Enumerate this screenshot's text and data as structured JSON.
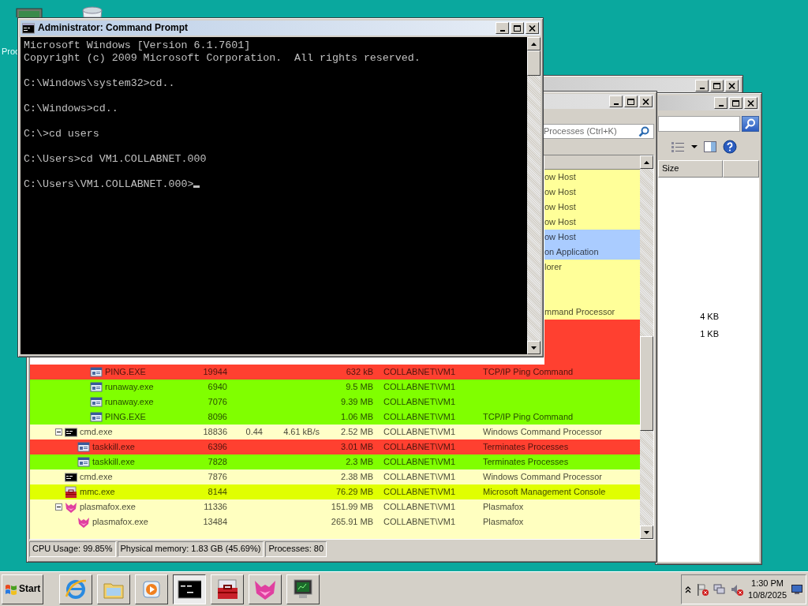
{
  "desktop": {
    "icon_label": "Proc"
  },
  "command_prompt": {
    "title": "Administrator: Command Prompt",
    "blocks": [
      [
        "Microsoft Windows [Version 6.1.7601]",
        "Copyright (c) 2009 Microsoft Corporation.  All rights reserved."
      ],
      [
        "C:\\Windows\\system32>cd.."
      ],
      [
        "C:\\Windows>cd.."
      ],
      [
        "C:\\>cd users"
      ],
      [
        "C:\\Users>cd VM1.COLLABNET.000"
      ],
      [
        "C:\\Users\\VM1.COLLABNET.000>"
      ]
    ],
    "cursor": true
  },
  "process_explorer": {
    "search": {
      "placeholder": "Processes (Ctrl+K)"
    },
    "rows": [
      {
        "kind": "covered",
        "description": "ow Host",
        "color": "#ffff99"
      },
      {
        "kind": "covered",
        "description": "ow Host",
        "color": "#ffff99"
      },
      {
        "kind": "covered",
        "description": "ow Host",
        "color": "#ffff99"
      },
      {
        "kind": "covered",
        "description": "ow Host",
        "color": "#ffff99"
      },
      {
        "kind": "covered",
        "description": "ow Host",
        "color": "#aaccff"
      },
      {
        "kind": "covered",
        "description": "on Application",
        "color": "#aaccff"
      },
      {
        "kind": "covered",
        "description": "lorer",
        "color": "#ffff99"
      },
      {
        "kind": "covered",
        "color": "#ffff99"
      },
      {
        "kind": "covered",
        "color": "#ffff99"
      },
      {
        "kind": "covered",
        "description": "mmand Processor",
        "color": "#ffff99",
        "children": [
          {
            "kind": "covered",
            "color": "#ff4030"
          },
          {
            "kind": "covered",
            "color": "#ff4030",
            "children": [
              {
                "kind": "covered",
                "color": "#ff4030"
              },
              {
                "kind": "window",
                "name": "PING.EXE",
                "pid": "19944",
                "memory": "632 kB",
                "user": "COLLABNET\\VM1",
                "description": "TCP/IP Ping Command",
                "color": "#ff4030",
                "expanded": false
              },
              {
                "kind": "window",
                "name": "runaway.exe",
                "pid": "6940",
                "memory": "9.5 MB",
                "user": "COLLABNET\\VM1",
                "color": "#80ff00",
                "expanded": false
              },
              {
                "kind": "window",
                "name": "runaway.exe",
                "pid": "7076",
                "memory": "9.39 MB",
                "user": "COLLABNET\\VM1",
                "color": "#80ff00",
                "expanded": false
              },
              {
                "kind": "window",
                "name": "PING.EXE",
                "pid": "8096",
                "memory": "1.06 MB",
                "user": "COLLABNET\\VM1",
                "description": "TCP/IP Ping Command",
                "color": "#80ff00",
                "expanded": false
              }
            ]
          }
        ]
      },
      {
        "kind": "console",
        "name": "cmd.exe",
        "pid": "18836",
        "cpu": "0.44",
        "io": "4.61 kB/s",
        "memory": "2.52 MB",
        "user": "COLLABNET\\VM1",
        "description": "Windows Command Processor",
        "color": "#ffffc8",
        "expanded": true,
        "children": [
          {
            "kind": "window",
            "name": "taskkill.exe",
            "pid": "6396",
            "memory": "3.01 MB",
            "user": "COLLABNET\\VM1",
            "description": "Terminates Processes",
            "color": "#ff4030",
            "expanded": false
          },
          {
            "kind": "window",
            "name": "taskkill.exe",
            "pid": "7828",
            "memory": "2.3 MB",
            "user": "COLLABNET\\VM1",
            "description": "Terminates Processes",
            "color": "#80ff00",
            "expanded": false
          }
        ]
      },
      {
        "kind": "console",
        "name": "cmd.exe",
        "pid": "7876",
        "memory": "2.38 MB",
        "user": "COLLABNET\\VM1",
        "description": "Windows Command Processor",
        "color": "#ffffc0",
        "expanded": false
      },
      {
        "kind": "toolbox",
        "name": "mmc.exe",
        "pid": "8144",
        "memory": "76.29 MB",
        "user": "COLLABNET\\VM1",
        "description": "Microsoft Management Console",
        "color": "#e0ff00",
        "expanded": false
      },
      {
        "kind": "fox",
        "name": "plasmafox.exe",
        "pid": "11336",
        "memory": "151.99 MB",
        "user": "COLLABNET\\VM1",
        "description": "Plasmafox",
        "color": "#ffffc0",
        "expanded": true,
        "children": [
          {
            "kind": "fox",
            "name": "plasmafox.exe",
            "pid": "13484",
            "memory": "265.91 MB",
            "user": "COLLABNET\\VM1",
            "description": "Plasmafox",
            "color": "#ffffc0",
            "expanded": false
          },
          {
            "kind": "cut",
            "color": "#ffffc0"
          }
        ]
      }
    ],
    "status_bar": [
      "CPU Usage: 99.85%",
      "Physical memory: 1.83 GB (45.69%)",
      "Processes: 80"
    ]
  },
  "explorer": {
    "columns": [
      "Size"
    ],
    "sizes": [
      "4 KB",
      "1 KB"
    ]
  },
  "taskbar": {
    "start": "Start",
    "apps": [
      {
        "kind": "browser",
        "selected": false
      },
      {
        "kind": "folder",
        "selected": false
      },
      {
        "kind": "media",
        "selected": false
      },
      {
        "kind": "console",
        "selected": true
      },
      {
        "kind": "toolbox",
        "selected": false
      },
      {
        "kind": "fox",
        "selected": false
      },
      {
        "kind": "monitor",
        "selected": false
      }
    ],
    "clock": {
      "time": "1:30 PM",
      "date": "10/8/2025"
    }
  }
}
